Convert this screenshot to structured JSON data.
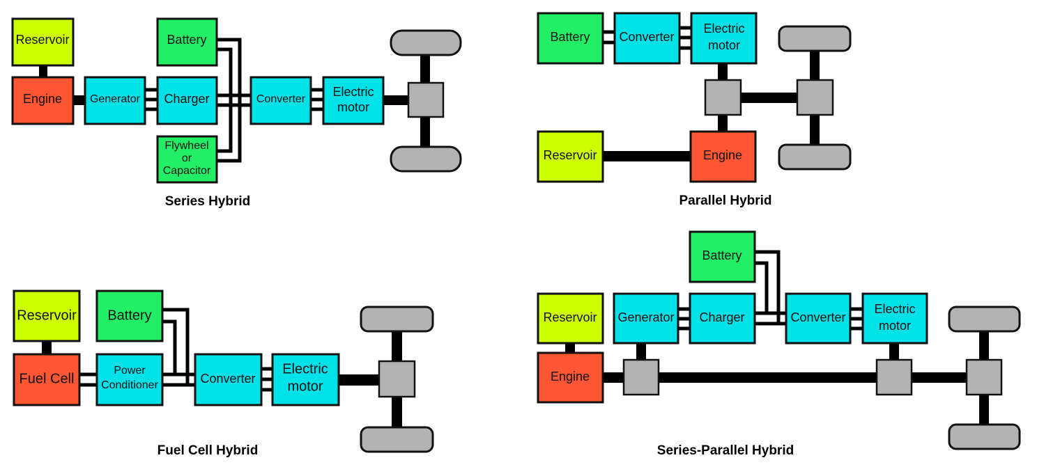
{
  "colors": {
    "reservoir": "#ccff00",
    "engine": "#ff5733",
    "electrical": "#00e1e8",
    "storage": "#22ee66",
    "mechanical": "#b3b3b3",
    "link": "#000000"
  },
  "diagrams": {
    "series": {
      "title": "Series Hybrid",
      "reservoir": "Reservoir",
      "engine": "Engine",
      "generator": "Generator",
      "charger": "Charger",
      "battery": "Battery",
      "flywheel": [
        "Flywheel",
        "or",
        "Capacitor"
      ],
      "converter": "Converter",
      "motor": [
        "Electric",
        "motor"
      ]
    },
    "parallel": {
      "title": "Parallel Hybrid",
      "battery": "Battery",
      "converter": "Converter",
      "motor": [
        "Electric",
        "motor"
      ],
      "reservoir": "Reservoir",
      "engine": "Engine"
    },
    "fuelcell": {
      "title": "Fuel Cell Hybrid",
      "reservoir": "Reservoir",
      "fuelcell": "Fuel Cell",
      "battery": "Battery",
      "conditioner": [
        "Power",
        "Conditioner"
      ],
      "converter": "Converter",
      "motor": [
        "Electric",
        "motor"
      ]
    },
    "seriesparallel": {
      "title": "Series-Parallel Hybrid",
      "battery": "Battery",
      "reservoir": "Reservoir",
      "generator": "Generator",
      "charger": "Charger",
      "converter": "Converter",
      "motor": [
        "Electric",
        "motor"
      ],
      "engine": "Engine"
    }
  }
}
